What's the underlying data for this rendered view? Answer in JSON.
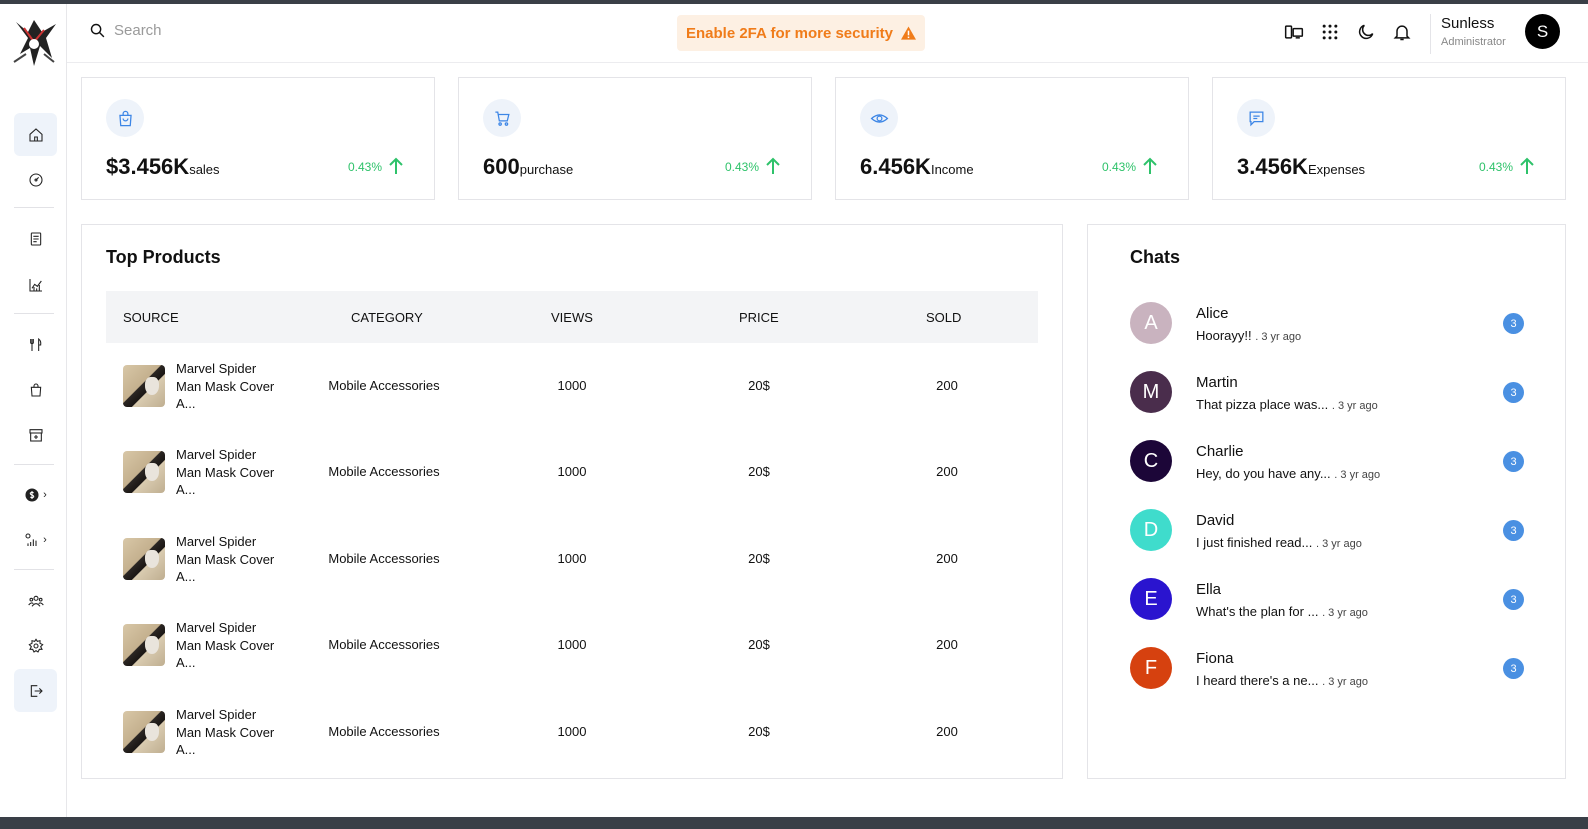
{
  "header": {
    "search_placeholder": "Search",
    "security_banner": "Enable 2FA for more security",
    "user_name": "Sunless",
    "user_role": "Administrator",
    "avatar_initial": "S"
  },
  "stats": [
    {
      "value": "$3.456K",
      "label": "sales",
      "change": "0.43%",
      "icon": "shopping-bag-icon"
    },
    {
      "value": "600",
      "label": "purchase",
      "change": "0.43%",
      "icon": "cart-icon"
    },
    {
      "value": "6.456K",
      "label": "Income",
      "change": "0.43%",
      "icon": "eye-icon"
    },
    {
      "value": "3.456K",
      "label": "Expenses",
      "change": "0.43%",
      "icon": "message-icon"
    }
  ],
  "products": {
    "title": "Top Products",
    "columns": [
      "SOURCE",
      "CATEGORY",
      "VIEWS",
      "PRICE",
      "SOLD"
    ],
    "rows": [
      {
        "name": "Marvel Spider Man Mask Cover A...",
        "category": "Mobile Accessories",
        "views": "1000",
        "price": "20$",
        "sold": "200"
      },
      {
        "name": "Marvel Spider Man Mask Cover A...",
        "category": "Mobile Accessories",
        "views": "1000",
        "price": "20$",
        "sold": "200"
      },
      {
        "name": "Marvel Spider Man Mask Cover A...",
        "category": "Mobile Accessories",
        "views": "1000",
        "price": "20$",
        "sold": "200"
      },
      {
        "name": "Marvel Spider Man Mask Cover A...",
        "category": "Mobile Accessories",
        "views": "1000",
        "price": "20$",
        "sold": "200"
      },
      {
        "name": "Marvel Spider Man Mask Cover A...",
        "category": "Mobile Accessories",
        "views": "1000",
        "price": "20$",
        "sold": "200"
      }
    ]
  },
  "chats": {
    "title": "Chats",
    "items": [
      {
        "initial": "A",
        "name": "Alice",
        "message": "Hoorayy!!",
        "ago": ". 3 yr ago",
        "unread": "3",
        "color": "#c9b3bf"
      },
      {
        "initial": "M",
        "name": "Martin",
        "message": "That pizza place was...",
        "ago": ". 3 yr ago",
        "unread": "3",
        "color": "#4a2d4c"
      },
      {
        "initial": "C",
        "name": "Charlie",
        "message": "Hey, do you have any...",
        "ago": ". 3 yr ago",
        "unread": "3",
        "color": "#1c0638"
      },
      {
        "initial": "D",
        "name": "David",
        "message": "I just finished read...",
        "ago": ". 3 yr ago",
        "unread": "3",
        "color": "#3fdccc"
      },
      {
        "initial": "E",
        "name": "Ella",
        "message": "What's the plan for ...",
        "ago": ". 3 yr ago",
        "unread": "3",
        "color": "#2a14cf"
      },
      {
        "initial": "F",
        "name": "Fiona",
        "message": "I heard there's a ne...",
        "ago": ". 3 yr ago",
        "unread": "3",
        "color": "#d6410f"
      }
    ]
  },
  "sidebar": {
    "icons": [
      "home-icon",
      "gauge-icon",
      "receipt-icon",
      "chart-icon",
      "utensils-icon",
      "bag-icon",
      "store-icon",
      "dollar-icon",
      "analytics-icon",
      "users-icon",
      "settings-icon",
      "logout-icon"
    ]
  },
  "colors": {
    "accent": "#3d86e6",
    "positive": "#2ec26a",
    "warning": "#f07c1a"
  }
}
